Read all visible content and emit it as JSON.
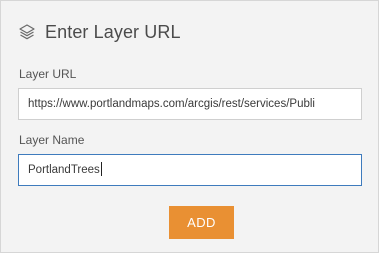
{
  "header": {
    "icon": "layers-icon",
    "title": "Enter Layer URL"
  },
  "form": {
    "url_label": "Layer URL",
    "url_value": "https://www.portlandmaps.com/arcgis/rest/services/Publi",
    "name_label": "Layer Name",
    "name_value": "PortlandTrees",
    "add_label": "ADD"
  },
  "colors": {
    "panel_background": "#f3f3f3",
    "accent_button": "#e99033",
    "focused_border": "#3e7bbd"
  }
}
